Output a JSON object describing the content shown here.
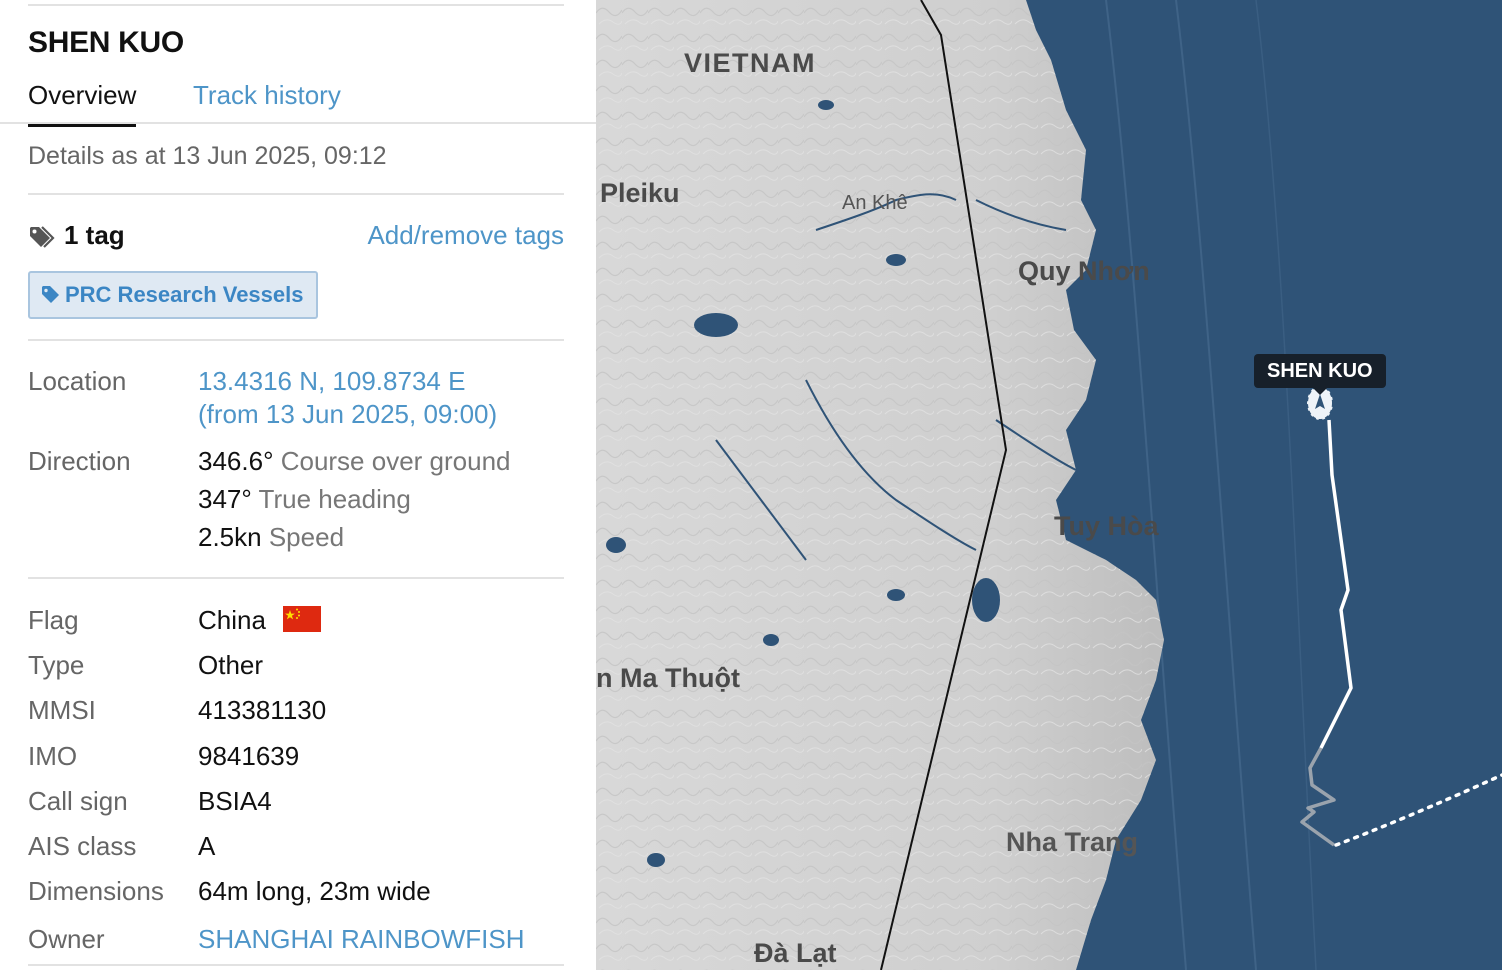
{
  "vessel": {
    "name": "SHEN KUO"
  },
  "tabs": [
    {
      "label": "Overview",
      "active": true
    },
    {
      "label": "Track history",
      "active": false
    }
  ],
  "details_as": "Details as at 13 Jun 2025, 09:12",
  "tags": {
    "count_label": "1 tag",
    "action_label": "Add/remove tags",
    "items": [
      "PRC Research Vessels"
    ]
  },
  "position": {
    "location_label": "Location",
    "coordinates": "13.4316 N, 109.8734 E",
    "from": "(from 13 Jun 2025, 09:00)",
    "direction_label": "Direction",
    "course_value": "346.6°",
    "course_label": "Course over ground",
    "heading_value": "347°",
    "heading_label": "True heading",
    "speed_value": "2.5kn",
    "speed_label": "Speed"
  },
  "info": {
    "flag_label": "Flag",
    "flag_value": "China",
    "type_label": "Type",
    "type_value": "Other",
    "mmsi_label": "MMSI",
    "mmsi_value": "413381130",
    "imo_label": "IMO",
    "imo_value": "9841639",
    "callsign_label": "Call sign",
    "callsign_value": "BSIA4",
    "ais_label": "AIS class",
    "ais_value": "A",
    "dimensions_label": "Dimensions",
    "dimensions_value": "64m long, 23m wide",
    "owner_label": "Owner",
    "owner_value": "SHANGHAI RAINBOWFISH"
  },
  "map": {
    "labels": {
      "vietnam": "VIETNAM",
      "pleiku": "Pleiku",
      "an_khe": "An Khê",
      "quy_nhon": "Quy Nhơn",
      "tuy_hoa": "Tuy Hòa",
      "ma_thuot": "n Ma Thuột",
      "nha_trang": "Nha Trang",
      "da_lat": "Đà Lạt"
    },
    "vessel_label": "SHEN KUO"
  },
  "colors": {
    "link": "#4e95c8",
    "sea": "#2f5377",
    "land": "#d6d6d6",
    "tag_bg": "#dfe9f3"
  }
}
